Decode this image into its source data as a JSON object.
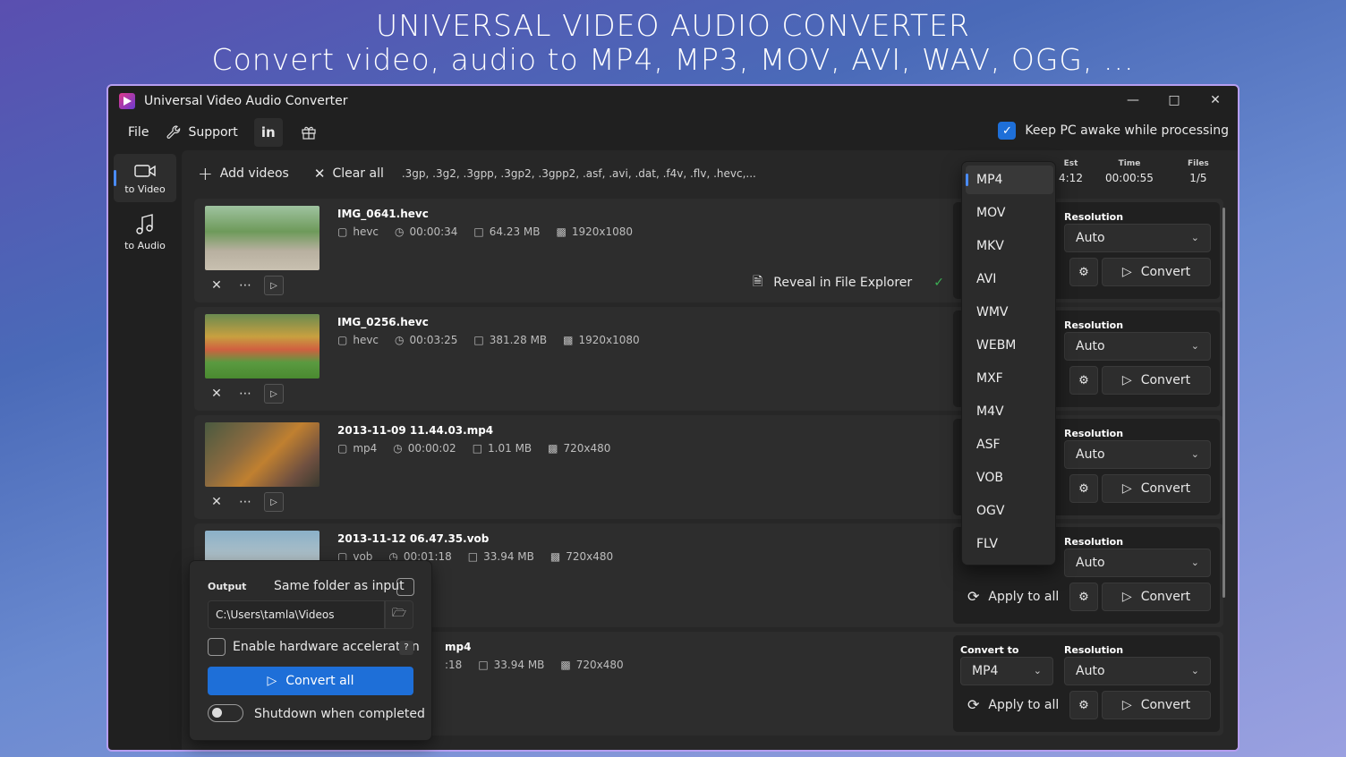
{
  "banner": {
    "line1": "UNIVERSAL VIDEO AUDIO CONVERTER",
    "line2": "Convert video, audio to MP4, MP3, MOV, AVI, WAV, OGG, ..."
  },
  "window": {
    "title": "Universal Video Audio Converter"
  },
  "menu": {
    "file": "File",
    "support": "Support",
    "linkedin": "in"
  },
  "keep_awake": {
    "label": "Keep PC awake while processing",
    "checked": true
  },
  "sidebar": {
    "video": "to Video",
    "audio": "to Audio"
  },
  "toolbar": {
    "add": "Add videos",
    "clear": "Clear all",
    "extensions": ".3gp, .3g2, .3gpp, .3gp2, .3gpp2, .asf, .avi, .dat, .f4v, .flv, .hevc,..."
  },
  "stats": {
    "est_label": "Est",
    "est_value": "4:12",
    "time_label": "Time",
    "time_value": "00:00:55",
    "files_label": "Files",
    "files_value": "1/5"
  },
  "files": [
    {
      "name": "IMG_0641.hevc",
      "format": "hevc",
      "duration": "00:00:34",
      "size": "64.23 MB",
      "res": "1920x1080"
    },
    {
      "name": "IMG_0256.hevc",
      "format": "hevc",
      "duration": "00:03:25",
      "size": "381.28 MB",
      "res": "1920x1080"
    },
    {
      "name": "2013-11-09 11.44.03.mp4",
      "format": "mp4",
      "duration": "00:00:02",
      "size": "1.01 MB",
      "res": "720x480"
    },
    {
      "name": "2013-11-12 06.47.35.vob",
      "format": "vob",
      "duration": "00:01:18",
      "size": "33.94 MB",
      "res": "720x480"
    },
    {
      "name_partial": "mp4",
      "duration_partial": ":18",
      "size": "33.94 MB",
      "res": "720x480"
    }
  ],
  "reveal": "Reveal in File Explorer",
  "labels": {
    "resolution": "Resolution",
    "convert_to": "Convert to",
    "auto": "Auto",
    "convert": "Convert",
    "apply_all": "Apply to all",
    "mp4": "MP4"
  },
  "formats": [
    "MP4",
    "MOV",
    "MKV",
    "AVI",
    "WMV",
    "WEBM",
    "MXF",
    "M4V",
    "ASF",
    "VOB",
    "OGV",
    "FLV"
  ],
  "output": {
    "title": "Output",
    "same_folder": "Same folder as input",
    "path": "C:\\Users\\tamla\\Videos",
    "hw_accel": "Enable hardware acceleration",
    "help": "?",
    "convert_all": "Convert all",
    "shutdown": "Shutdown when completed"
  },
  "colors": {
    "accent": "#1e6fd8",
    "window_border": "#b69ef0",
    "bg": "#202020"
  }
}
